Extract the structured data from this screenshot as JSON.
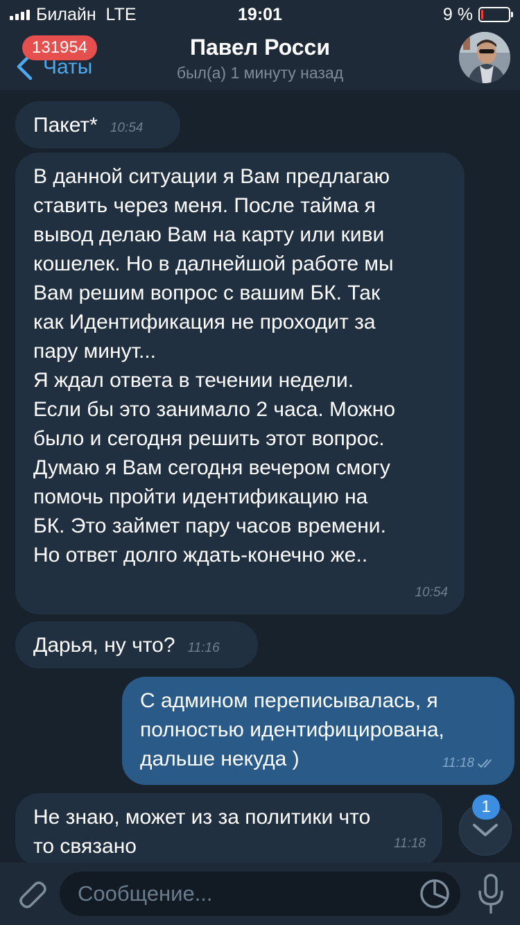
{
  "status_bar": {
    "carrier": "Билайн",
    "network": "LTE",
    "time": "19:01",
    "battery": "9 %",
    "battery_level": 0.09,
    "battery_color": "#ff3b30"
  },
  "header": {
    "back_label": "Чаты",
    "unread_count": "131954",
    "title": "Павел Росси",
    "subtitle": "был(а) 1 минуту назад"
  },
  "messages": [
    {
      "direction": "in",
      "text": "Пакет*",
      "time": "10:54"
    },
    {
      "direction": "in",
      "text": "В данной ситуации я Вам предлагаю\nставить через меня. После тайма я\nвывод делаю Вам на карту или киви\nкошелек. Но в далнейшой работе мы\nВам решим вопрос с вашим БК. Так\nкак Идентификация не проходит за\nпару минут...\nЯ ждал ответа в течении недели.\nЕсли бы это занимало 2 часа. Можно\nбыло и сегодня решить этот вопрос.\nДумаю я Вам сегодня вечером смогу\nпомочь пройти идентификацию на\nБК. Это займет пару часов времени.\nНо ответ долго ждать-конечно же..",
      "time": "10:54"
    },
    {
      "direction": "in",
      "text": "Дарья, ну что?",
      "time": "11:16"
    },
    {
      "direction": "out",
      "text": "С админом переписывалась, я\nполностью идентифицирована,\nдальше некуда )",
      "time": "11:18",
      "status_icon": "double-check-icon"
    },
    {
      "direction": "in",
      "text": "Не знаю, может из за политики что\nто связано",
      "time": "11:18"
    }
  ],
  "scroll_down": {
    "badge": "1"
  },
  "input": {
    "placeholder": "Сообщение..."
  },
  "colors": {
    "background": "#18222d",
    "bar": "#1e2a38",
    "incoming_bubble": "#213041",
    "outgoing_bubble": "#2a5a87",
    "accent": "#4fa9ef",
    "badge_red": "#e5504f",
    "badge_blue": "#3b8ee0"
  },
  "icons": {
    "back": "chevron-left-icon",
    "attach": "paperclip-icon",
    "sticker": "sticker-icon",
    "mic": "microphone-icon",
    "scroll": "chevron-down-icon"
  }
}
